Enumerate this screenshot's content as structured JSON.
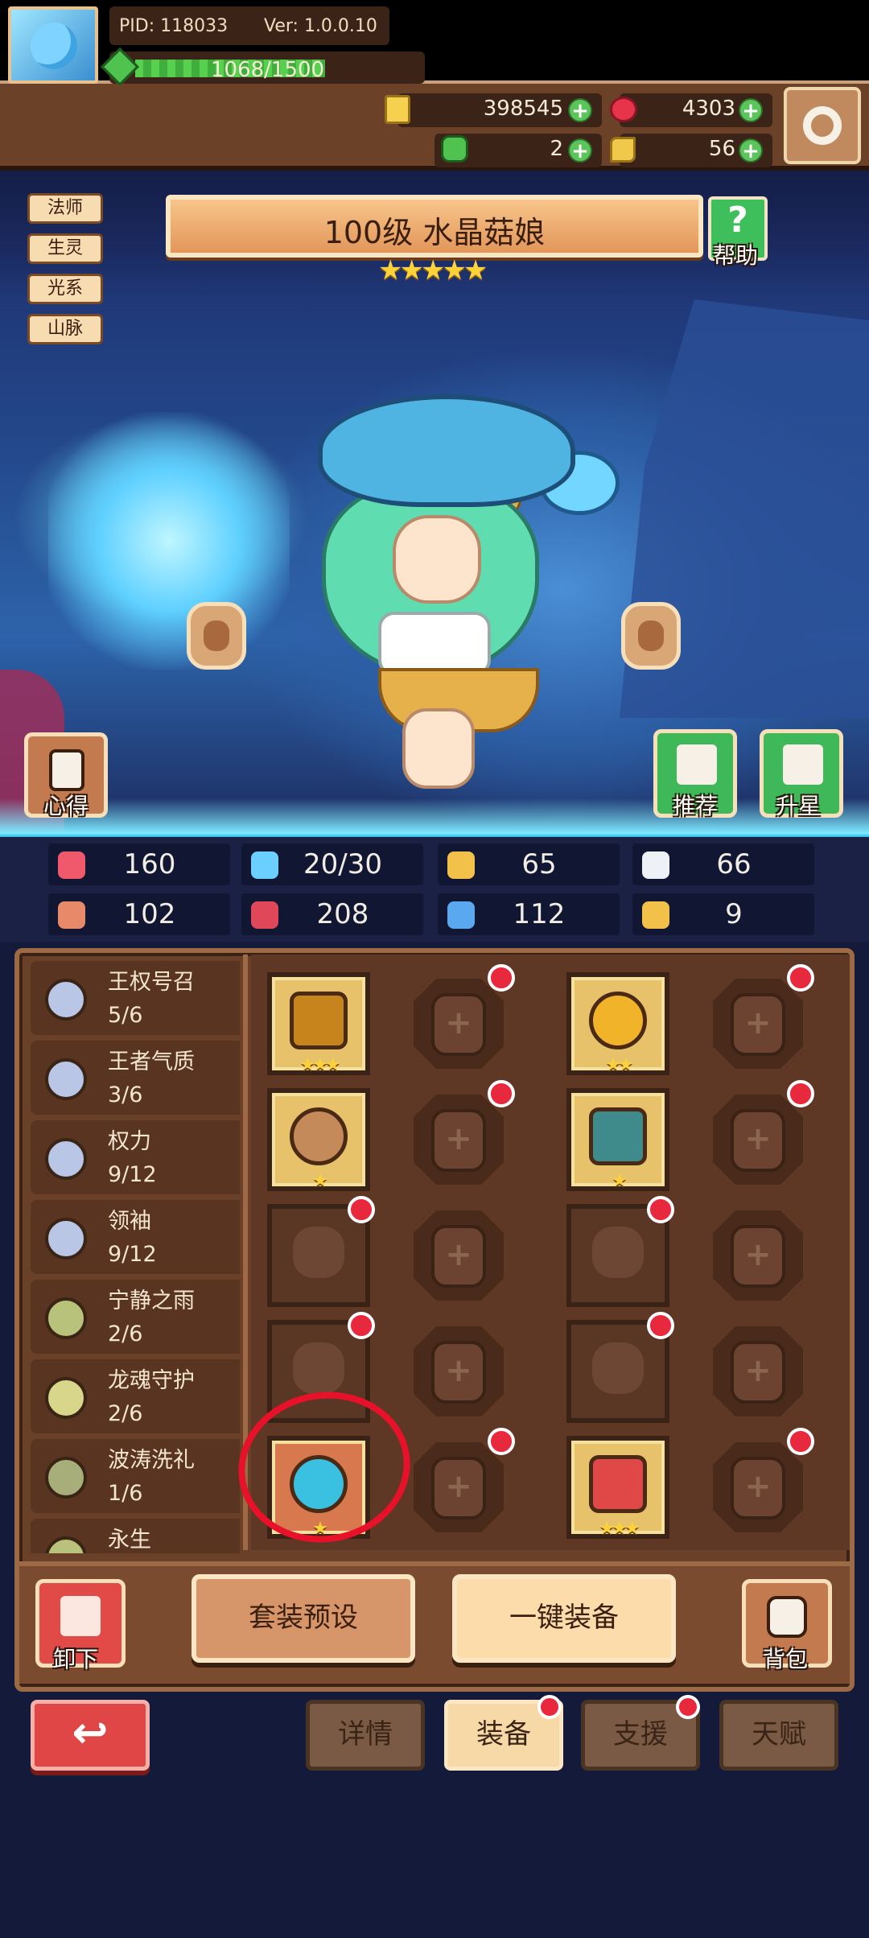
{
  "header": {
    "pid": "PID: 118033",
    "version": "Ver: 1.0.0.10",
    "exp": "1068/1500",
    "gold": "398545",
    "gems": "4303",
    "clover": "2",
    "keys": "56",
    "settings_icon": "gear-icon"
  },
  "hero": {
    "name": "100级 水晶菇娘",
    "stars": "★★★★★",
    "tags": [
      "法师",
      "生灵",
      "光系",
      "山脉"
    ],
    "help_label": "帮助",
    "notes_label": "心得",
    "recommend_label": "推荐",
    "upgrade_label": "升星"
  },
  "stats": [
    {
      "icon": "heart-icon",
      "value": "160",
      "color": "#f0596b"
    },
    {
      "icon": "water-drop-icon",
      "value": "20/30",
      "color": "#6bd0ff"
    },
    {
      "icon": "shield-icon",
      "value": "65",
      "color": "#f2c14a"
    },
    {
      "icon": "wing-icon",
      "value": "66",
      "color": "#eef2f6"
    },
    {
      "icon": "fist-icon",
      "value": "102",
      "color": "#e88a6a"
    },
    {
      "icon": "book-icon",
      "value": "208",
      "color": "#e0485a"
    },
    {
      "icon": "boot-icon",
      "value": "112",
      "color": "#5aa8f0"
    },
    {
      "icon": "horseshoe-icon",
      "value": "9",
      "color": "#f2c14a"
    }
  ],
  "sets": [
    {
      "name": "王权号召",
      "progress": "5/6",
      "coin": "#b9c6e6"
    },
    {
      "name": "王者气质",
      "progress": "3/6",
      "coin": "#b9c6e6"
    },
    {
      "name": "权力",
      "progress": "9/12",
      "coin": "#b9c6e6"
    },
    {
      "name": "领袖",
      "progress": "9/12",
      "coin": "#b9c6e6"
    },
    {
      "name": "宁静之雨",
      "progress": "2/6",
      "coin": "#b8c27a"
    },
    {
      "name": "龙魂守护",
      "progress": "2/6",
      "coin": "#d8d68a"
    },
    {
      "name": "波涛洗礼",
      "progress": "1/6",
      "coin": "#a8ae7a"
    },
    {
      "name": "永生",
      "progress": "",
      "coin": "#b8c27a"
    }
  ],
  "equipment": {
    "slot_stars": [
      "★★★",
      "★★",
      "★",
      "★",
      "★",
      "★★★"
    ]
  },
  "actions": {
    "unload": "卸下",
    "preset": "套装预设",
    "equip_all": "一键装备",
    "bag": "背包"
  },
  "nav": {
    "back_icon": "↩",
    "tabs": [
      "详情",
      "装备",
      "支援",
      "天赋"
    ]
  }
}
